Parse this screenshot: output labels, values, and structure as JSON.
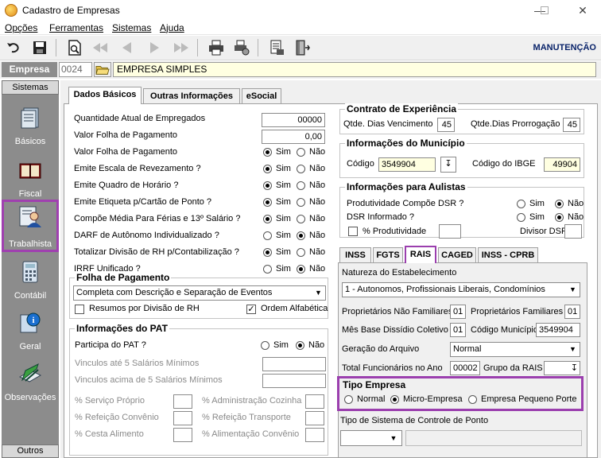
{
  "window": {
    "title": "Cadastro de Empresas"
  },
  "menu": [
    "Opções",
    "Ferramentas",
    "Sistemas",
    "Ajuda"
  ],
  "mode": "MANUTENÇÃO",
  "empresa": {
    "label": "Empresa",
    "code": "0024",
    "name": "EMPRESA SIMPLES"
  },
  "sidebar": {
    "header": "Sistemas",
    "footer": "Outros",
    "items": [
      "Básicos",
      "Fiscal",
      "Trabalhista",
      "Contábil",
      "Geral",
      "Observações"
    ]
  },
  "tabs": [
    "Dados Básicos",
    "Outras Informações",
    "eSocial"
  ],
  "dados": {
    "rows": [
      "Quantidade Atual de Empregados",
      "Valor Folha de Pagamento",
      "Emite Escala de Revezamento ?",
      "Emite Quadro de Horário ?",
      "Emite Etiqueta p/Cartão de Ponto ?",
      "Compõe Média Para Férias e 13º Salário ?",
      "DARF de Autônomo Individualizado ?",
      "Totalizar Divisão de RH p/Contabilização ?",
      "IRRF Unificado ?"
    ],
    "qtd": "00000",
    "valor": "0,00",
    "sim": "Sim",
    "nao": "Não",
    "radios": [
      "sim",
      "sim",
      "sim",
      "sim",
      "sim",
      "nao",
      "sim",
      "nao"
    ]
  },
  "folha": {
    "title": "Folha de Pagamento",
    "select": "Completa com Descrição e Separação de Eventos",
    "resumos": "Resumos por Divisão de RH",
    "ordem": "Ordem Alfabética"
  },
  "pat": {
    "title": "Informações do PAT",
    "participa": "Participa do PAT ?",
    "ate5": "Vinculos até 5 Salários Mínimos",
    "acima5": "Vinculos acima de 5 Salários Mínimos",
    "proprio": "% Serviço Próprio",
    "admin": "% Administração Cozinha",
    "refconv": "% Refeição Convênio",
    "reftrans": "% Refeição Transporte",
    "cesta": "% Cesta Alimento",
    "alimconv": "% Alimentação Convênio"
  },
  "contrato": {
    "title": "Contrato de Experiência",
    "venc": "Qtde. Dias Vencimento",
    "venc_v": "45",
    "prorr": "Qtde.Dias Prorrogação",
    "prorr_v": "45"
  },
  "municipio": {
    "title": "Informações do Município",
    "codigo": "Código",
    "codigo_v": "3549904",
    "ibge": "Código do IBGE",
    "ibge_v": "49904"
  },
  "aulistas": {
    "title": "Informações para Aulistas",
    "prod": "Produtividade Compõe DSR ?",
    "dsr": "DSR Informado ?",
    "pct": "% Produtividade",
    "divisor": "Divisor DSR"
  },
  "subtabs": [
    "INSS",
    "FGTS",
    "RAIS",
    "CAGED",
    "INSS - CPRB"
  ],
  "rais": {
    "natureza": "Natureza do Estabelecimento",
    "natureza_v": "1 - Autonomos, Profissionais Liberais, Condomínios",
    "propnf": "Proprietários Não Familiares",
    "propnf_v": "01",
    "propf": "Proprietários Familiares",
    "propf_v": "01",
    "mesbase": "Mês Base Dissídio Coletivo",
    "mesbase_v": "01",
    "codmun": "Código Município",
    "codmun_v": "3549904",
    "geracao": "Geração do  Arquivo",
    "geracao_v": "Normal",
    "total": "Total Funcionários no Ano",
    "total_v": "00002",
    "grupo": "Grupo da RAIS",
    "tipo_title": "Tipo Empresa",
    "tipos": [
      "Normal",
      "Micro-Empresa",
      "Empresa Pequeno Porte"
    ],
    "ponto": "Tipo de Sistema de Controle de Ponto"
  }
}
